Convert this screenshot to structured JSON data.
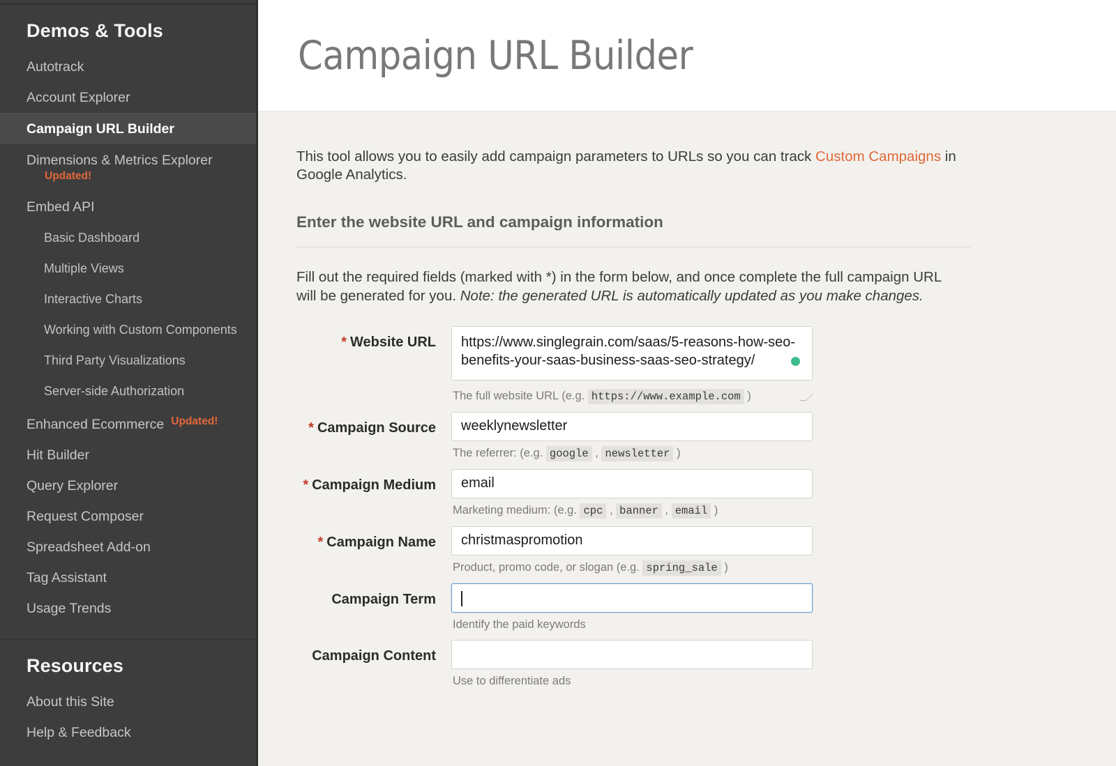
{
  "sidebar": {
    "demos_title": "Demos & Tools",
    "items": [
      {
        "label": "Autotrack",
        "level": "top",
        "active": false
      },
      {
        "label": "Account Explorer",
        "level": "top",
        "active": false
      },
      {
        "label": "Campaign URL Builder",
        "level": "top",
        "active": true
      },
      {
        "label": "Dimensions & Metrics Explorer",
        "level": "top",
        "active": false,
        "badge": "Updated!",
        "badge_position": "below"
      },
      {
        "label": "Embed API",
        "level": "group",
        "active": false
      },
      {
        "label": "Basic Dashboard",
        "level": "sub",
        "active": false
      },
      {
        "label": "Multiple Views",
        "level": "sub",
        "active": false
      },
      {
        "label": "Interactive Charts",
        "level": "sub",
        "active": false
      },
      {
        "label": "Working with Custom Components",
        "level": "sub",
        "active": false
      },
      {
        "label": "Third Party Visualizations",
        "level": "sub",
        "active": false
      },
      {
        "label": "Server-side Authorization",
        "level": "sub",
        "active": false
      },
      {
        "label": "Enhanced Ecommerce",
        "level": "top",
        "active": false,
        "badge": "Updated!",
        "badge_position": "inline"
      },
      {
        "label": "Hit Builder",
        "level": "top",
        "active": false
      },
      {
        "label": "Query Explorer",
        "level": "top",
        "active": false
      },
      {
        "label": "Request Composer",
        "level": "top",
        "active": false
      },
      {
        "label": "Spreadsheet Add-on",
        "level": "top",
        "active": false
      },
      {
        "label": "Tag Assistant",
        "level": "top",
        "active": false
      },
      {
        "label": "Usage Trends",
        "level": "top",
        "active": false
      }
    ],
    "resources_title": "Resources",
    "resources": [
      {
        "label": "About this Site"
      },
      {
        "label": "Help & Feedback"
      }
    ],
    "colors": {
      "background": "#3d3d3d",
      "active_background": "#4a4a4a",
      "text": "#c6c6c6",
      "badge": "#e2673a"
    }
  },
  "header": {
    "title": "Campaign URL Builder"
  },
  "intro": {
    "before_link": "This tool allows you to easily add campaign parameters to URLs so you can track ",
    "link_text": "Custom Campaigns",
    "after_link": " in Google Analytics."
  },
  "section": {
    "heading": "Enter the website URL and campaign information",
    "lede_plain": "Fill out the required fields (marked with *) in the form below, and once complete the full campaign URL will be generated for you. ",
    "lede_italic": "Note: the generated URL is automatically updated as you make changes."
  },
  "form": {
    "fields": [
      {
        "id": "website-url",
        "label": "Website URL",
        "required": true,
        "required_marker": "*",
        "value": "https://www.singlegrain.com/saas/5-reasons-how-seo-benefits-your-saas-business-saas-seo-strategy/",
        "placeholder": "",
        "type": "textarea",
        "focused": false,
        "status_dot_color": "#3dbd8e",
        "help_prefix": "The full website URL (e.g. ",
        "help_codes": [
          "https://www.example.com"
        ],
        "help_suffix": ")"
      },
      {
        "id": "campaign-source",
        "label": "Campaign Source",
        "required": true,
        "required_marker": "*",
        "value": "weeklynewsletter",
        "placeholder": "",
        "type": "text",
        "focused": false,
        "help_prefix": "The referrer: (e.g. ",
        "help_codes": [
          "google",
          "newsletter"
        ],
        "help_suffix": ")"
      },
      {
        "id": "campaign-medium",
        "label": "Campaign Medium",
        "required": true,
        "required_marker": "*",
        "value": "email",
        "placeholder": "",
        "type": "text",
        "focused": false,
        "help_prefix": "Marketing medium: (e.g. ",
        "help_codes": [
          "cpc",
          "banner",
          "email"
        ],
        "help_suffix": ")"
      },
      {
        "id": "campaign-name",
        "label": "Campaign Name",
        "required": true,
        "required_marker": "*",
        "value": "christmaspromotion",
        "placeholder": "",
        "type": "text",
        "focused": false,
        "help_prefix": "Product, promo code, or slogan (e.g. ",
        "help_codes": [
          "spring_sale"
        ],
        "help_suffix": ")"
      },
      {
        "id": "campaign-term",
        "label": "Campaign Term",
        "required": false,
        "required_marker": "",
        "value": "",
        "placeholder": "",
        "type": "text",
        "focused": true,
        "help_prefix": "Identify the paid keywords",
        "help_codes": [],
        "help_suffix": ""
      },
      {
        "id": "campaign-content",
        "label": "Campaign Content",
        "required": false,
        "required_marker": "",
        "value": "",
        "placeholder": "",
        "type": "text",
        "focused": false,
        "help_prefix": "Use to differentiate ads",
        "help_codes": [],
        "help_suffix": ""
      }
    ]
  }
}
